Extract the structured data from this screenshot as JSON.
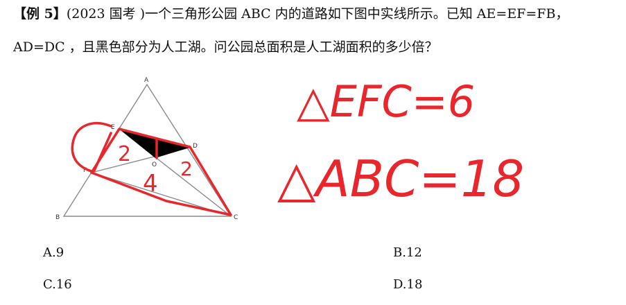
{
  "question": {
    "tag": "【例 5】",
    "source": "(2023 国考 )",
    "line1_text": "一个三角形公园 ABC 内的道路如下图中实线所示。已知 AE=EF=FB，",
    "line2_text": "AD=DC ，且黑色部分为人工湖。问公园总面积是人工湖面积的多少倍？"
  },
  "figure": {
    "vertex_labels": {
      "A": "A",
      "B": "B",
      "C": "C",
      "D": "D",
      "E": "E",
      "F": "F",
      "O": "O"
    }
  },
  "handwriting": {
    "area_label_top": "2",
    "area_label_bottom": "4",
    "area_label_right": "2",
    "note_efc": "△EFC=6",
    "note_abc": "△ABC=18"
  },
  "options": [
    {
      "label": "A.9"
    },
    {
      "label": "B.12"
    },
    {
      "label": "C.16"
    },
    {
      "label": "D.18"
    }
  ],
  "colors": {
    "ink_red": "#e8262b",
    "lake_black": "#000000",
    "road_gray": "#8a8a8a"
  }
}
